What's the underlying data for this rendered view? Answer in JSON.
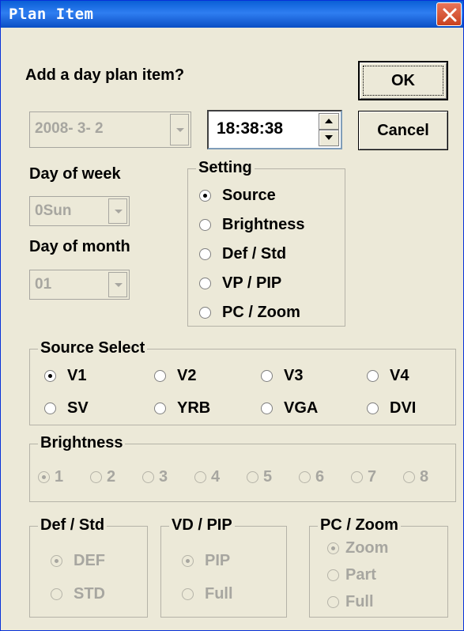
{
  "window": {
    "title": "Plan Item"
  },
  "prompt": "Add a day plan item?",
  "buttons": {
    "ok": "OK",
    "cancel": "Cancel"
  },
  "date": {
    "value": "2008- 3- 2"
  },
  "time": {
    "value": "18:38:38"
  },
  "day_of_week": {
    "label": "Day of week",
    "value": "0Sun"
  },
  "day_of_month": {
    "label": "Day of month",
    "value": "01"
  },
  "setting": {
    "title": "Setting",
    "options": [
      "Source",
      "Brightness",
      "Def / Std",
      "VP / PIP",
      "PC / Zoom"
    ],
    "selected": "Source"
  },
  "source_select": {
    "title": "Source Select",
    "options": [
      "V1",
      "V2",
      "V3",
      "V4",
      "SV",
      "YRB",
      "VGA",
      "DVI"
    ],
    "selected": "V1"
  },
  "brightness": {
    "title": "Brightness",
    "options": [
      "1",
      "2",
      "3",
      "4",
      "5",
      "6",
      "7",
      "8"
    ],
    "selected": "1"
  },
  "def_std": {
    "title": "Def / Std",
    "options": [
      "DEF",
      "STD"
    ],
    "selected": "DEF"
  },
  "vd_pip": {
    "title": "VD / PIP",
    "options": [
      "PIP",
      "Full"
    ],
    "selected": "PIP"
  },
  "pc_zoom": {
    "title": "PC / Zoom",
    "options": [
      "Zoom",
      "Part",
      "Full"
    ],
    "selected": "Zoom"
  },
  "colors": {
    "title_bar": "#0a5fd6",
    "face": "#ece9d8",
    "disabled_text": "#a7a6a0",
    "close_button": "#d9532e"
  }
}
